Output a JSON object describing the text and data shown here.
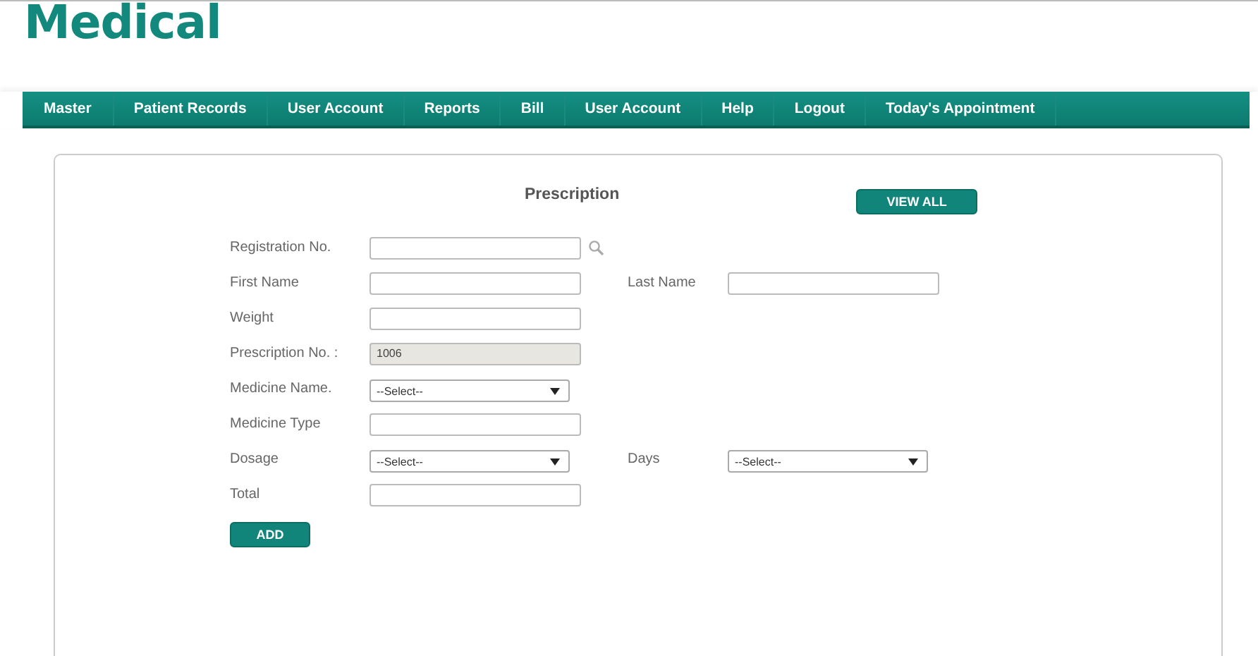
{
  "logo": "Medical",
  "nav": [
    "Master",
    "Patient Records",
    "User Account",
    "Reports",
    "Bill",
    "User Account",
    "Help",
    "Logout",
    "Today's Appointment"
  ],
  "form": {
    "title": "Prescription",
    "view_all": "VIEW ALL",
    "rows": [
      {
        "fields": [
          {
            "label": "Registration No.",
            "kind": "search"
          }
        ]
      },
      {
        "fields": [
          {
            "label": "First Name",
            "kind": "text"
          },
          {
            "label": "Last Name",
            "kind": "text"
          }
        ]
      },
      {
        "fields": [
          {
            "label": "Weight",
            "kind": "text"
          }
        ]
      },
      {
        "fields": [
          {
            "label": "Prescription No. :",
            "kind": "readonly",
            "value": "1006"
          }
        ]
      },
      {
        "fields": [
          {
            "label": "Medicine Name.",
            "kind": "select",
            "value": "--Select--"
          }
        ]
      },
      {
        "fields": [
          {
            "label": "Medicine Type",
            "kind": "text"
          }
        ]
      },
      {
        "fields": [
          {
            "label": "Dosage",
            "kind": "select",
            "value": "--Select--"
          },
          {
            "label": "Days",
            "kind": "select",
            "value": "--Select--"
          }
        ]
      },
      {
        "fields": [
          {
            "label": "Total",
            "kind": "text"
          }
        ]
      }
    ],
    "add": "ADD"
  }
}
